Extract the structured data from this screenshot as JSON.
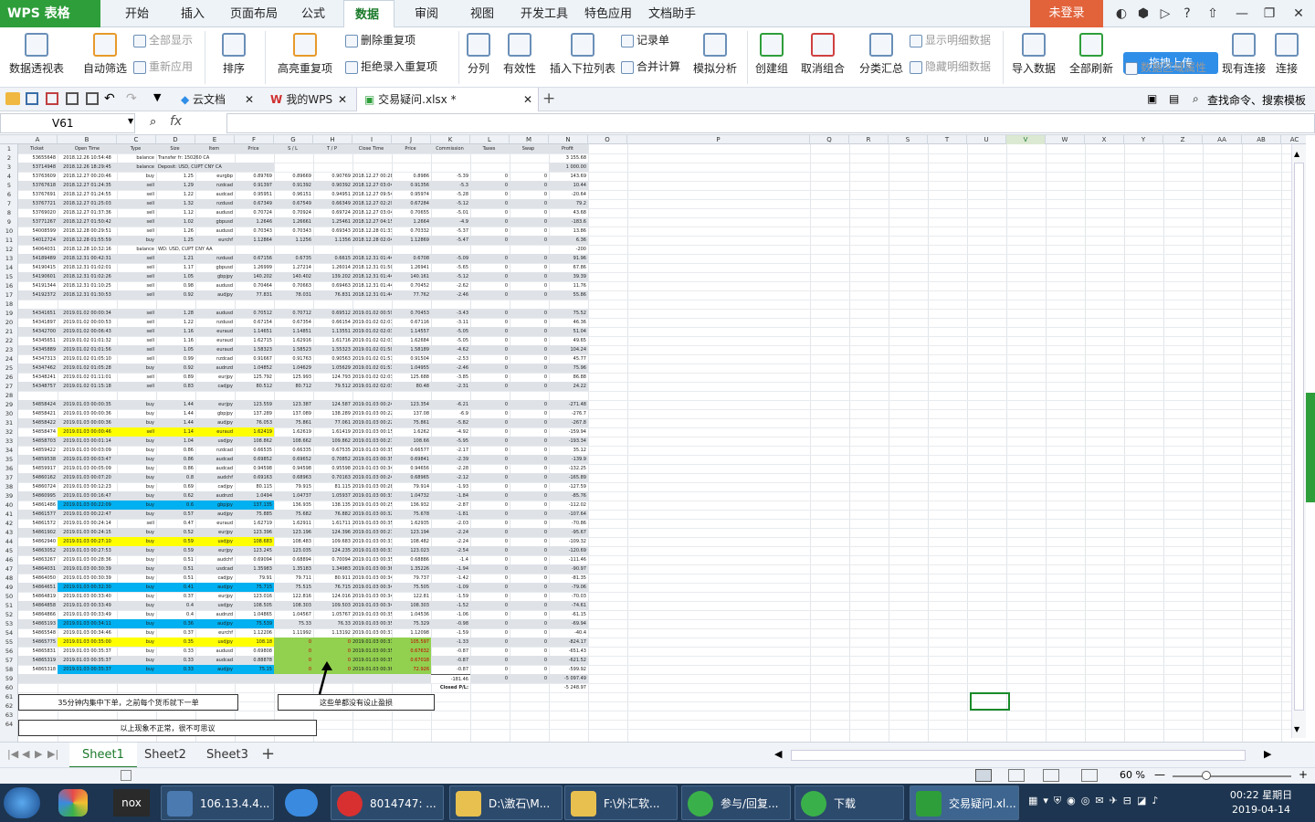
{
  "app": {
    "logo": "WPS 表格",
    "login": "未登录",
    "upload": "拖拽上传",
    "search": "查找命令、搜索模板"
  },
  "menu": [
    "开始",
    "插入",
    "页面布局",
    "公式",
    "数据",
    "审阅",
    "视图",
    "开发工具",
    "特色应用",
    "文档助手"
  ],
  "menu_active": 4,
  "ribbon": {
    "pivot": "数据透视表",
    "autofilter": "自动筛选",
    "showall": "全部显示",
    "reapply": "重新应用",
    "sort": "排序",
    "highlight_dup": "高亮重复项",
    "delete_dup": "删除重复项",
    "reject_dup": "拒绝录入重复项",
    "split": "分列",
    "validity": "有效性",
    "insert_dropdown": "插入下拉列表",
    "record": "记录单",
    "consolidate": "合并计算",
    "simulate": "模拟分析",
    "group": "创建组",
    "ungroup": "取消组合",
    "subtotal": "分类汇总",
    "show_detail": "显示明细数据",
    "hide_detail": "隐藏明细数据",
    "import": "导入数据",
    "refresh_all": "全部刷新",
    "data_area": "数据区域属性",
    "existing_conn": "现有连接",
    "connect": "连接"
  },
  "tabs": {
    "cloud": "云文档",
    "mywps": "我的WPS",
    "file": "交易疑问.xlsx *"
  },
  "namebox": "V61",
  "fx": "fx",
  "columns": [
    "A",
    "B",
    "C",
    "D",
    "E",
    "F",
    "G",
    "H",
    "I",
    "J",
    "K",
    "L",
    "M",
    "N",
    "O",
    "P",
    "Q",
    "R",
    "S",
    "T",
    "U",
    "V",
    "W",
    "X",
    "Y",
    "Z",
    "AA",
    "AB",
    "AC"
  ],
  "selected_col": "V",
  "header": [
    "Ticket",
    "Open Time",
    "Type",
    "Size",
    "Item",
    "Price",
    "S / L",
    "T / P",
    "Close Time",
    "Price",
    "Commission",
    "Taxes",
    "Swap",
    "Profit"
  ],
  "rows": [
    [
      "53655648",
      "2018.12.26 10:54:48",
      "balance",
      "Transfer fr: 150260 CA",
      "",
      "",
      "",
      "",
      "",
      "",
      "",
      "",
      "",
      "3 155.68"
    ],
    [
      "53714948",
      "2018.12.26 18:29:45",
      "balance",
      "Deposit: USD,  CUPT CNY CA",
      "",
      "",
      "",
      "",
      "",
      "",
      "",
      "",
      "",
      "1 000.00"
    ],
    [
      "53763609",
      "2018.12.27 00:20:46",
      "buy",
      "1.25",
      "eurgbp",
      "0.89769",
      "0.89669",
      "0.90769",
      "2018.12.27 00:28:28",
      "0.8986",
      "-5.39",
      "0",
      "0",
      "143.69"
    ],
    [
      "53767618",
      "2018.12.27 01:24:35",
      "sell",
      "1.29",
      "nzdcad",
      "0.91397",
      "0.91392",
      "0.90392",
      "2018.12.27 03:04:40",
      "0.91356",
      "-5.3",
      "0",
      "0",
      "10.44"
    ],
    [
      "53767691",
      "2018.12.27 01:24:55",
      "sell",
      "1.22",
      "audcad",
      "0.95951",
      "0.96151",
      "0.94951",
      "2018.12.27 09:54:44",
      "0.95974",
      "-5.28",
      "0",
      "0",
      "-20.64"
    ],
    [
      "53767721",
      "2018.12.27 01:25:03",
      "sell",
      "1.32",
      "nzdusd",
      "0.67349",
      "0.67549",
      "0.66349",
      "2018.12.27 02:29:58",
      "0.67284",
      "-5.12",
      "0",
      "0",
      "79.2"
    ],
    [
      "53769020",
      "2018.12.27 01:37:36",
      "sell",
      "1.12",
      "audusd",
      "0.70724",
      "0.70924",
      "0.69724",
      "2018.12.27 03:04:37",
      "0.70655",
      "-5.01",
      "0",
      "0",
      "43.68"
    ],
    [
      "53771267",
      "2018.12.27 01:50:42",
      "sell",
      "1.02",
      "gbpusd",
      "1.2646",
      "1.26661",
      "1.25461",
      "2018.12.27 04:15:28",
      "1.2664",
      "-4.9",
      "0",
      "0",
      "-183.6"
    ],
    [
      "54008599",
      "2018.12.28 00:29:51",
      "sell",
      "1.26",
      "audusd",
      "0.70343",
      "0.70343",
      "0.69343",
      "2018.12.28 01:33:16",
      "0.70332",
      "-5.37",
      "0",
      "0",
      "13.86"
    ],
    [
      "54012724",
      "2018.12.28 01:55:59",
      "buy",
      "1.25",
      "eurchf",
      "1.12864",
      "1.1256",
      "1.1356",
      "2018.12.28 02:04:34",
      "1.12869",
      "-5.47",
      "0",
      "0",
      "6.36"
    ],
    [
      "54064031",
      "2018.12.28 10:32:16",
      "balance",
      "WD: USD,  CUPT CNY AA",
      "",
      "",
      "",
      "",
      "",
      "",
      "",
      "",
      "",
      "-200"
    ],
    [
      "54189489",
      "2018.12.31 00:42:31",
      "sell",
      "1.21",
      "nzdusd",
      "0.67156",
      "0.6735",
      "0.6615",
      "2018.12.31 01:44:46",
      "0.6708",
      "-5.09",
      "0",
      "0",
      "91.96"
    ],
    [
      "54190415",
      "2018.12.31 01:02:01",
      "sell",
      "1.17",
      "gbpusd",
      "1.26999",
      "1.27214",
      "1.26014",
      "2018.12.31 01:50:59",
      "1.26941",
      "-5.65",
      "0",
      "0",
      "67.86"
    ],
    [
      "54190601",
      "2018.12.31 01:02:26",
      "sell",
      "1.05",
      "gbpjpy",
      "140.202",
      "140.402",
      "139.202",
      "2018.12.31 01:44:50",
      "140.161",
      "-5.12",
      "0",
      "0",
      "39.39"
    ],
    [
      "54191344",
      "2018.12.31 01:10:25",
      "sell",
      "0.98",
      "audusd",
      "0.70464",
      "0.70663",
      "0.69463",
      "2018.12.31 01:44:52",
      "0.70452",
      "-2.62",
      "0",
      "0",
      "11.76"
    ],
    [
      "54192372",
      "2018.12.31 01:30:53",
      "sell",
      "0.92",
      "audjpy",
      "77.831",
      "78.031",
      "76.831",
      "2018.12.31 01:44:46",
      "77.762",
      "-2.46",
      "0",
      "0",
      "55.86"
    ],
    [],
    [
      "54341651",
      "2019.01.02 00:00:34",
      "sell",
      "1.28",
      "audusd",
      "0.70512",
      "0.70712",
      "0.69512",
      "2019.01.02 00:59:55",
      "0.70453",
      "-3.43",
      "0",
      "0",
      "75.52"
    ],
    [
      "54341897",
      "2019.01.02 00:00:53",
      "sell",
      "1.22",
      "nzdusd",
      "0.67154",
      "0.67354",
      "0.66154",
      "2019.01.02 02:01:58",
      "0.67116",
      "-3.11",
      "0",
      "0",
      "46.36"
    ],
    [
      "54342700",
      "2019.01.02 00:06:43",
      "sell",
      "1.16",
      "euraud",
      "1.14651",
      "1.14851",
      "1.13551",
      "2019.01.02 02:03:14",
      "1.14557",
      "-5.05",
      "0",
      "0",
      "51.04"
    ],
    [
      "54345651",
      "2019.01.02 01:01:32",
      "sell",
      "1.16",
      "euraud",
      "1.62715",
      "1.62916",
      "1.61716",
      "2019.01.02 02:03:13",
      "1.62684",
      "-5.05",
      "0",
      "0",
      "49.65"
    ],
    [
      "54345889",
      "2019.01.02 01:01:56",
      "sell",
      "1.05",
      "euraud",
      "1.58323",
      "1.58523",
      "1.55323",
      "2019.01.02 01:50:24",
      "1.58189",
      "-4.62",
      "0",
      "0",
      "104.24"
    ],
    [
      "54347313",
      "2019.01.02 01:05:10",
      "sell",
      "0.99",
      "nzdcad",
      "0.91667",
      "0.91763",
      "0.90563",
      "2019.01.02 01:51:45",
      "0.91504",
      "-2.53",
      "0",
      "0",
      "45.77"
    ],
    [
      "54347462",
      "2019.01.02 01:05:28",
      "buy",
      "0.92",
      "audnzd",
      "1.04852",
      "1.04629",
      "1.05629",
      "2019.01.02 01:51:48",
      "1.04955",
      "-2.46",
      "0",
      "0",
      "75.96"
    ],
    [
      "54348241",
      "2019.01.02 01:11:01",
      "sell",
      "0.89",
      "eurjpy",
      "125.792",
      "125.993",
      "124.793",
      "2019.01.02 02:03:15",
      "125.688",
      "-3.85",
      "0",
      "0",
      "86.88"
    ],
    [
      "54348757",
      "2019.01.02 01:15:18",
      "sell",
      "0.83",
      "cadjpy",
      "80.512",
      "80.712",
      "79.512",
      "2019.01.02 02:03:16",
      "80.48",
      "-2.31",
      "0",
      "0",
      "24.22"
    ],
    [],
    [
      "54858424",
      "2019.01.03 00:00:35",
      "buy",
      "1.44",
      "eurjpy",
      "123.559",
      "123.387",
      "124.587",
      "2019.01.03 00:24:07",
      "123.354",
      "-6.21",
      "0",
      "0",
      "-271.48"
    ],
    [
      "54858421",
      "2019.01.03 00:00:36",
      "buy",
      "1.44",
      "gbpjpy",
      "137.289",
      "137.089",
      "138.289",
      "2019.01.03 00:22:05",
      "137.08",
      "-6.9",
      "0",
      "0",
      "-276.7"
    ],
    [
      "54858422",
      "2019.01.03 00:00:36",
      "buy",
      "1.44",
      "audjpy",
      "76.053",
      "75.861",
      "77.061",
      "2019.01.03 00:22:48",
      "75.861",
      "-5.82",
      "0",
      "0",
      "-267.8"
    ],
    [
      "54858474",
      "2019.01.03 00:00:46",
      "sell",
      "1.14",
      "euraud",
      "1.62419",
      "1.62619",
      "1.61419",
      "2019.01.03 00:15:41",
      "1.6262",
      "-4.92",
      "0",
      "0",
      "-159.94"
    ],
    [
      "54858703",
      "2019.01.03 00:01:14",
      "buy",
      "1.04",
      "usdjpy",
      "108.862",
      "108.662",
      "109.862",
      "2019.01.03 00:27:08",
      "108.66",
      "-5.95",
      "0",
      "0",
      "-193.34"
    ],
    [
      "54859422",
      "2019.01.03 00:03:09",
      "buy",
      "0.86",
      "nzdcad",
      "0.66535",
      "0.66335",
      "0.67535",
      "2019.01.03 00:35:42",
      "0.66577",
      "-2.17",
      "0",
      "0",
      "35.12"
    ],
    [
      "54859538",
      "2019.01.03 00:03:47",
      "buy",
      "0.86",
      "audcad",
      "0.69852",
      "0.69652",
      "0.70852",
      "2019.01.03 00:35:28",
      "0.69841",
      "-2.39",
      "0",
      "0",
      "-139.9"
    ],
    [
      "54859917",
      "2019.01.03 00:05:09",
      "buy",
      "0.86",
      "audcad",
      "0.94598",
      "0.94598",
      "0.95598",
      "2019.01.03 00:34:05",
      "0.94656",
      "-2.28",
      "0",
      "0",
      "-132.25"
    ],
    [
      "54860162",
      "2019.01.03 00:07:20",
      "buy",
      "0.8",
      "audchf",
      "0.69163",
      "0.68963",
      "0.70163",
      "2019.01.03 00:24:18",
      "0.68965",
      "-2.12",
      "0",
      "0",
      "-165.89"
    ],
    [
      "54860724",
      "2019.01.03 00:12:23",
      "buy",
      "0.69",
      "cadjpy",
      "80.115",
      "79.915",
      "81.115",
      "2019.01.03 00:28:46",
      "79.914",
      "-1.93",
      "0",
      "0",
      "-127.59"
    ],
    [
      "54860995",
      "2019.01.03 00:16:47",
      "buy",
      "0.62",
      "audnzd",
      "1.0494",
      "1.04737",
      "1.05937",
      "2019.01.03 00:33:53",
      "1.04732",
      "-1.84",
      "0",
      "0",
      "-85.76"
    ],
    [
      "54861486",
      "2019.01.03 00:22:09",
      "buy",
      "0.6",
      "gbpjpy",
      "137.135",
      "136.935",
      "138.135",
      "2019.01.03 00:25:12",
      "136.932",
      "-2.87",
      "0",
      "0",
      "-112.02"
    ],
    [
      "54861577",
      "2019.01.03 00:22:47",
      "buy",
      "0.57",
      "audjpy",
      "75.885",
      "75.682",
      "76.882",
      "2019.01.03 00:32:23",
      "75.678",
      "-1.81",
      "0",
      "0",
      "-107.64"
    ],
    [
      "54861572",
      "2019.01.03 00:24:14",
      "sell",
      "0.47",
      "euraud",
      "1.62719",
      "1.62911",
      "1.61711",
      "2019.01.03 00:35:38",
      "1.62935",
      "-2.03",
      "0",
      "0",
      "-70.86"
    ],
    [
      "54861902",
      "2019.01.03 00:24:15",
      "buy",
      "0.52",
      "eurjpy",
      "123.396",
      "123.196",
      "124.396",
      "2019.01.03 00:27:51",
      "123.194",
      "-2.24",
      "0",
      "0",
      "-95.67"
    ],
    [
      "54862940",
      "2019.01.03 00:27:10",
      "buy",
      "0.59",
      "usdjpy",
      "108.683",
      "108.483",
      "109.683",
      "2019.01.03 00:33:52",
      "108.482",
      "-2.24",
      "0",
      "0",
      "-109.32"
    ],
    [
      "54863052",
      "2019.01.03 00:27:53",
      "buy",
      "0.59",
      "eurjpy",
      "123.245",
      "123.035",
      "124.235",
      "2019.01.03 00:33:27",
      "123.023",
      "-2.54",
      "0",
      "0",
      "-120.69"
    ],
    [
      "54863267",
      "2019.01.03 00:28:36",
      "buy",
      "0.51",
      "audchf",
      "0.69094",
      "0.68894",
      "0.70094",
      "2019.01.03 00:35:26",
      "0.68886",
      "-1.4",
      "0",
      "0",
      "-111.46"
    ],
    [
      "54864031",
      "2019.01.03 00:30:39",
      "buy",
      "0.51",
      "usdcad",
      "1.35983",
      "1.35183",
      "1.34983",
      "2019.01.03 00:36:32",
      "1.35226",
      "-1.94",
      "0",
      "0",
      "-90.97"
    ],
    [
      "54864050",
      "2019.01.03 00:30:39",
      "buy",
      "0.51",
      "cadjpy",
      "79.91",
      "79.711",
      "80.911",
      "2019.01.03 00:34:02",
      "79.737",
      "-1.42",
      "0",
      "0",
      "-81.35"
    ],
    [
      "54864651",
      "2019.01.03 00:32:30",
      "buy",
      "0.41",
      "audjpy",
      "75.715",
      "75.515",
      "76.715",
      "2019.01.03 00:34:08",
      "75.505",
      "-1.09",
      "0",
      "0",
      "-79.06"
    ],
    [
      "54864819",
      "2019.01.03 00:33:40",
      "buy",
      "0.37",
      "eurjpy",
      "123.016",
      "122.816",
      "124.016",
      "2019.01.03 00:34:27",
      "122.81",
      "-1.59",
      "0",
      "0",
      "-70.03"
    ],
    [
      "54864858",
      "2019.01.03 00:33:49",
      "buy",
      "0.4",
      "usdjpy",
      "108.505",
      "108.303",
      "109.503",
      "2019.01.03 00:34:49",
      "108.303",
      "-1.52",
      "0",
      "0",
      "-74.61"
    ],
    [
      "54864866",
      "2019.01.03 00:33:49",
      "buy",
      "0.4",
      "audnzd",
      "1.04865",
      "1.04567",
      "1.05767",
      "2019.01.03 00:35:38",
      "1.04536",
      "-1.06",
      "0",
      "0",
      "-61.15"
    ],
    [
      "54865193",
      "2019.01.03 00:34:11",
      "buy",
      "0.36",
      "audjpy",
      "75.539",
      "75.33",
      "76.33",
      "2019.01.03 00:35:10",
      "75.329",
      "-0.98",
      "0",
      "0",
      "-69.94"
    ],
    [
      "54865548",
      "2019.01.03 00:34:46",
      "buy",
      "0.37",
      "eurchf",
      "1.12206",
      "1.11992",
      "1.13192",
      "2019.01.03 00:37:56",
      "1.12098",
      "-1.59",
      "0",
      "0",
      "-40.4"
    ],
    [
      "54865775",
      "2019.01.03 00:35:00",
      "buy",
      "0.35",
      "usdjpy",
      "108.18",
      "0",
      "0",
      "2019.01.03 00:37:35",
      "105.597",
      "-1.33",
      "0",
      "0",
      "-824.17"
    ],
    [
      "54865831",
      "2019.01.03 00:35:37",
      "buy",
      "0.33",
      "audusd",
      "0.69808",
      "0",
      "0",
      "2019.01.03 00:35:37",
      "0.67632",
      "-0.87",
      "0",
      "0",
      "-651.43"
    ],
    [
      "54865319",
      "2019.01.03 00:35:37",
      "buy",
      "0.33",
      "audcad",
      "0.88878",
      "0",
      "0",
      "2019.01.03 00:35:38",
      "0.67018",
      "-0.87",
      "0",
      "0",
      "-621.52"
    ],
    [
      "54865318",
      "2019.01.03 00:35:37",
      "buy",
      "0.33",
      "audjpy",
      "75.15",
      "0",
      "0",
      "2019.01.03 00:36:27",
      "72.926",
      "-0.87",
      "0",
      "0",
      "-599.92"
    ],
    [
      "",
      "",
      "",
      "",
      "",
      "",
      "",
      "",
      "",
      "",
      "-181.46",
      "0",
      "0",
      "-5 097.49"
    ],
    [
      "",
      "",
      "",
      "",
      "",
      "",
      "",
      "",
      "",
      "",
      "Closed P/L:",
      "",
      "",
      "-5 248.97"
    ]
  ],
  "notes": {
    "n1": "35分钟内集中下单，之前每个货币就下一单",
    "n2": "这些单都没有设止盈损",
    "n3": "以上现象不正常，很不可思议"
  },
  "sheets": [
    "Sheet1",
    "Sheet2",
    "Sheet3"
  ],
  "status": {
    "zoom": "60 %"
  },
  "taskbar": {
    "items": [
      "106.13.4.4...",
      "8014747: ...",
      "D:\\激石\\M...",
      "F:\\外汇软...",
      "参与/回复...",
      "下载",
      "交易疑问.xl..."
    ],
    "time": "00:22 星期日",
    "date": "2019-04-14"
  },
  "colors": {
    "yellow": "#ffff00",
    "blue": "#00b0f0",
    "green": "#92d050",
    "accent": "#2e9e3a"
  }
}
